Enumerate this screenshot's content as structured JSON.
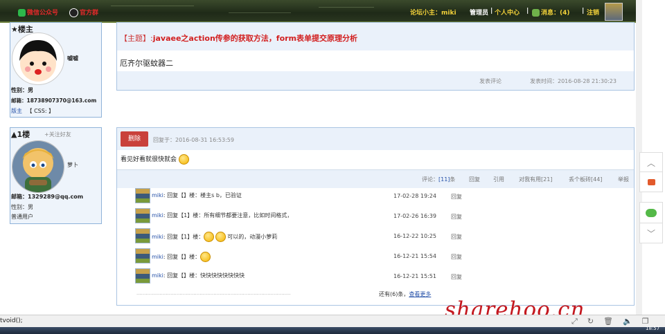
{
  "header": {
    "wechat_link": "微信公众号",
    "qq_link": "官方群",
    "moderator_label": "论坛小主：",
    "moderator_name": "miki",
    "admin_label": "管理员",
    "user_center": "个人中心",
    "messages_label": "消息：(4)",
    "logout": "注销"
  },
  "op_card": {
    "heading": "★楼主",
    "nickname": "嘘嘘",
    "gender": "性别：男",
    "email": "邮箱：18738907370@163.com",
    "role": "版主",
    "css_label": "【 CSS: 】"
  },
  "floor1_card": {
    "heading": "▲1楼",
    "follow": "+关注好友",
    "nickname": "萝卜",
    "email": "邮箱：1329289@qq.com",
    "gender": "性别：男",
    "role": "普通用户"
  },
  "op_post": {
    "title_prefix": "【主题】:",
    "title": "javaee之action传参的获取方法，form表单提交原理分析",
    "body": "厄齐尔驱蚊器二",
    "comment_action": "发表评论",
    "time_label": "发表时间：",
    "time": "2016-08-28 21:30:23"
  },
  "floor1_post": {
    "delete_button": "删除",
    "reply_time_label": "回复于：",
    "reply_time": "2016-08-31 16:53:59",
    "body": "看见好看就很快就会",
    "actions": {
      "comments_prefix": "评论：",
      "comments_count": "[11]",
      "comments_suffix": "条",
      "reply": "回复",
      "quote": "引用",
      "useful": "对我有用[21]",
      "brick": "丢个板砖[44]",
      "report": "举报"
    },
    "replies": [
      {
        "user": "miki",
        "text": "回复【】楼：楼主s b，已验证",
        "emojis": 0,
        "after": "",
        "time": "17-02-28 19:24",
        "reply": "回复"
      },
      {
        "user": "miki",
        "text": "回复【1】楼：所有细节都要注意，比如时间格式，",
        "emojis": 0,
        "after": "",
        "time": "17-02-26 16:39",
        "reply": "回复"
      },
      {
        "user": "miki",
        "text": "回复【1】楼：",
        "emojis": 2,
        "after": "可以的，动漫小萝莉",
        "time": "16-12-22 10:25",
        "reply": "回复"
      },
      {
        "user": "miki",
        "text": "回复【】楼：",
        "emojis": 1,
        "after": "",
        "time": "16-12-21 15:54",
        "reply": "回复"
      },
      {
        "user": "miki",
        "text": "回复【】楼：快快快快快快快快",
        "emojis": 0,
        "after": "",
        "time": "16-12-21 15:51",
        "reply": "回复"
      }
    ],
    "more_dots": "....................................................................................................",
    "more_count": "还有(6)条，",
    "more_link": "查看更多"
  },
  "status": {
    "text": "tvoid();",
    "watermark": "sharehoo.cn",
    "clock": "18:57"
  },
  "colors": {
    "accent_blue": "#8fb3d9",
    "title_red": "#d21f1f",
    "delete_red": "#c9413b",
    "header_yellow": "#f3d23a",
    "watermark_red": "#c4181f"
  }
}
